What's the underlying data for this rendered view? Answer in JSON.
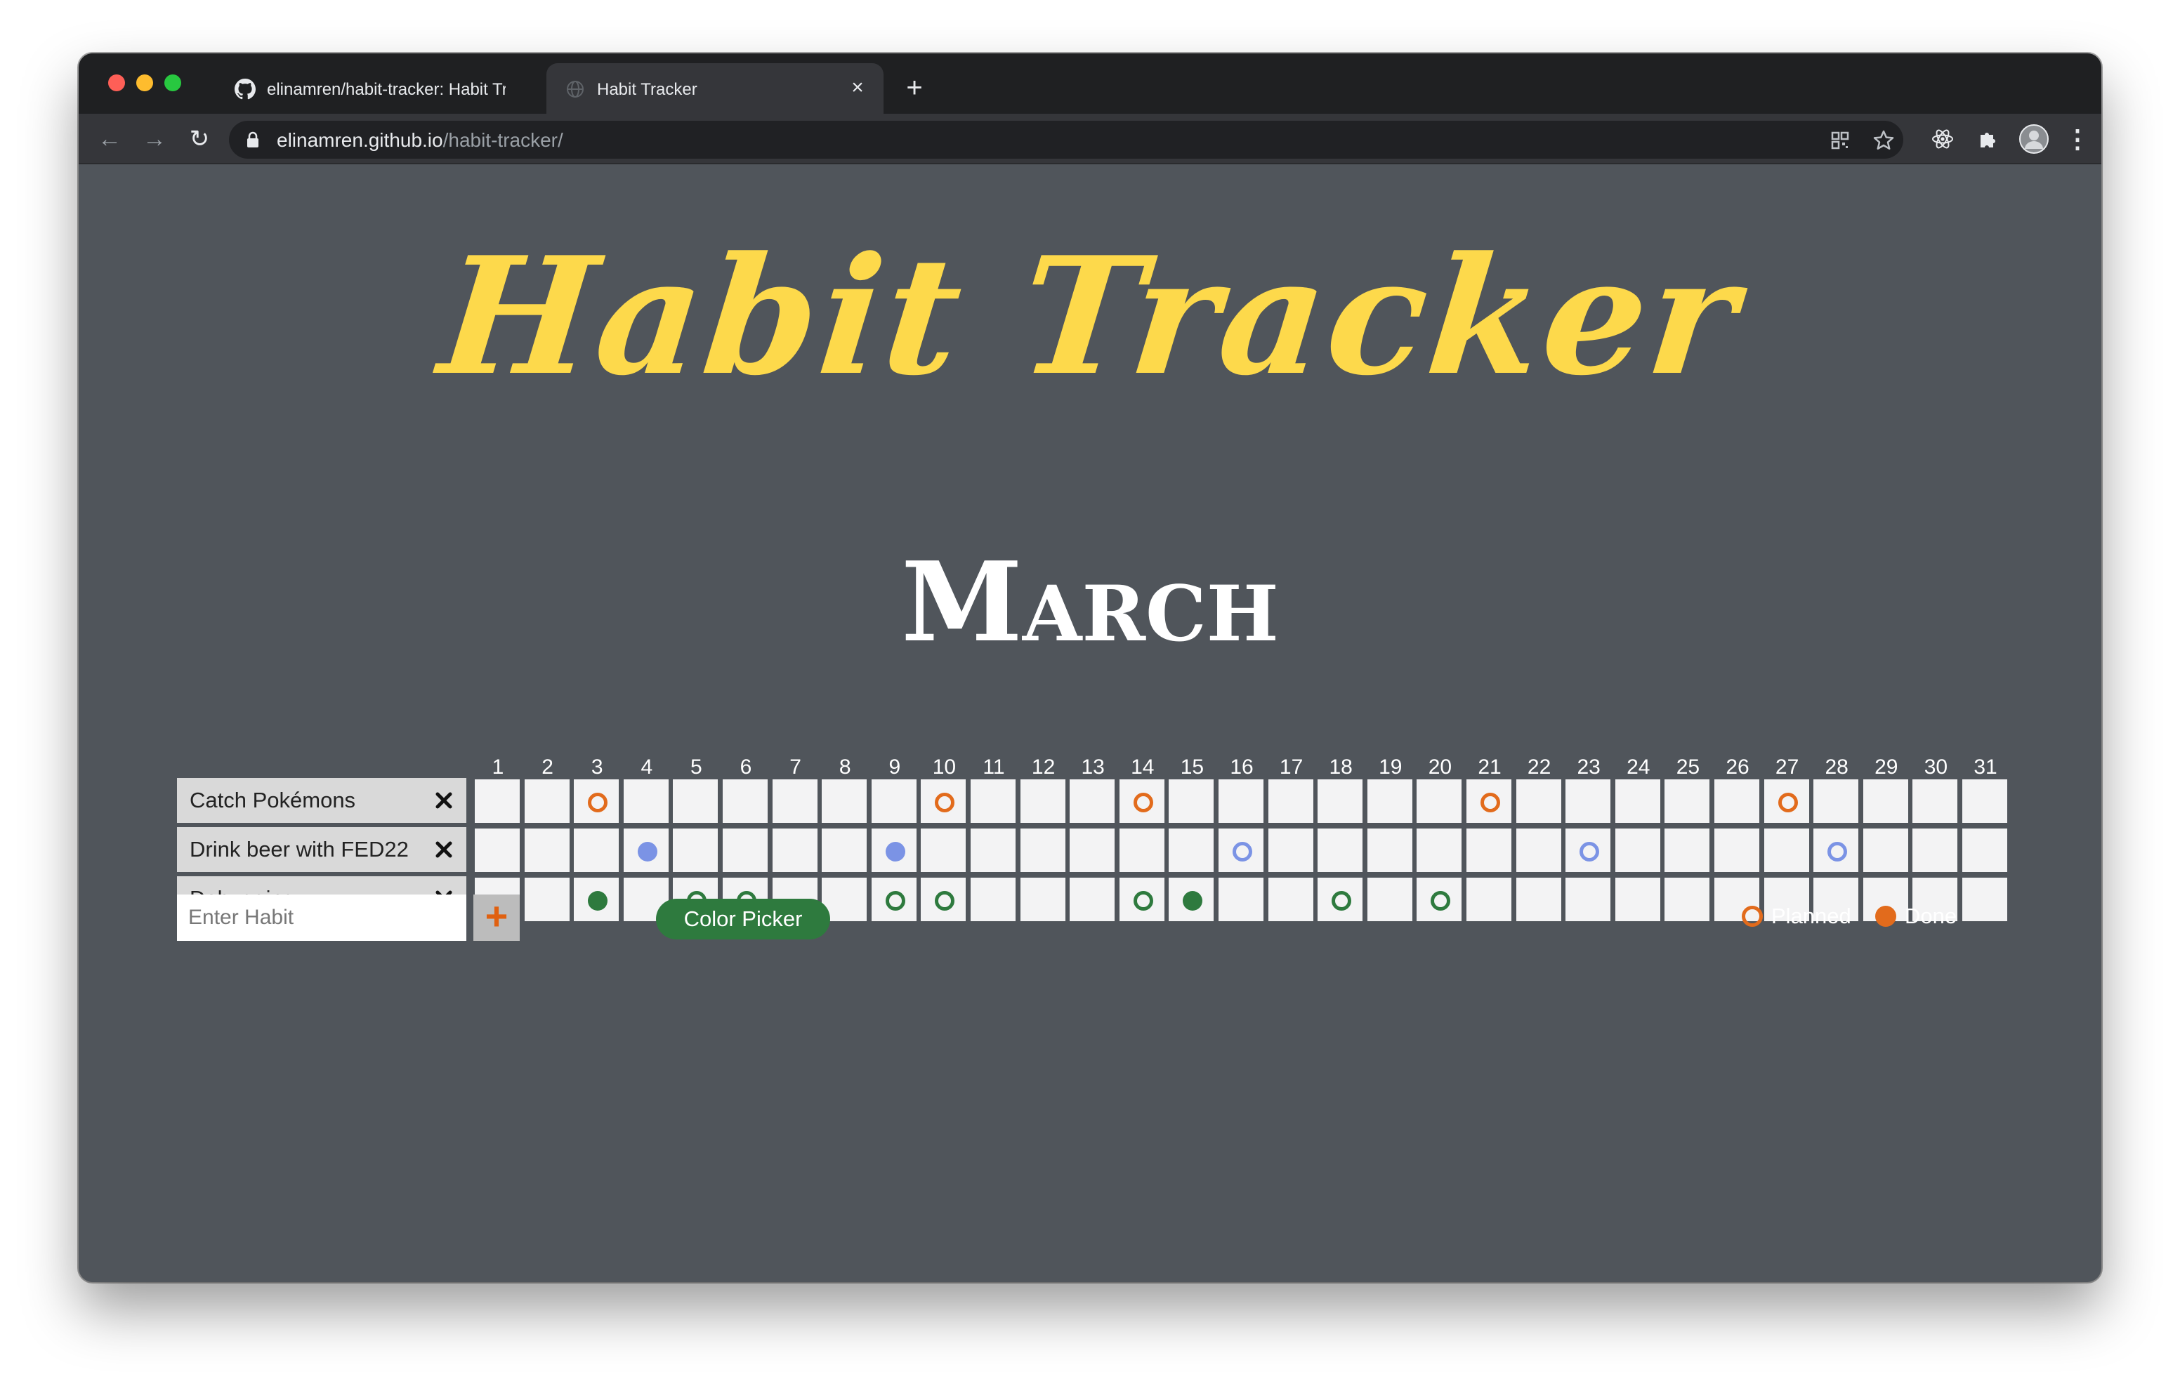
{
  "browser": {
    "tabs": [
      {
        "title": "elinamren/habit-tracker: Habit Tracker",
        "close_label": "×"
      },
      {
        "title": "Habit Tracker",
        "close_label": "×"
      }
    ],
    "new_tab_label": "+",
    "back_label": "←",
    "forward_label": "→",
    "reload_label": "↻",
    "url_host": "elinamren.github.io",
    "url_path": "/habit-tracker/",
    "menu_label": "⋮"
  },
  "app": {
    "title": "Habit Tracker",
    "month": "March",
    "days": [
      "1",
      "2",
      "3",
      "4",
      "5",
      "6",
      "7",
      "8",
      "9",
      "10",
      "11",
      "12",
      "13",
      "14",
      "15",
      "16",
      "17",
      "18",
      "19",
      "20",
      "21",
      "22",
      "23",
      "24",
      "25",
      "26",
      "27",
      "28",
      "29",
      "30",
      "31"
    ],
    "habits": [
      {
        "name": "Catch Pokémons",
        "color": "#e26b1c",
        "marks": {
          "3": "planned",
          "10": "planned",
          "14": "planned",
          "21": "planned",
          "27": "planned"
        }
      },
      {
        "name": "Drink beer with FED22",
        "color": "#7b93e5",
        "marks": {
          "4": "done",
          "9": "done",
          "16": "planned",
          "23": "planned",
          "28": "planned"
        }
      },
      {
        "name": "Debugging",
        "color": "#2e7a3e",
        "marks": {
          "3": "done",
          "5": "planned",
          "6": "planned",
          "9": "planned",
          "10": "planned",
          "14": "planned",
          "15": "done",
          "18": "planned",
          "20": "planned"
        }
      }
    ],
    "input_placeholder": "Enter Habit",
    "add_label": "+",
    "color_picker_label": "Color Picker",
    "legend": {
      "planned_label": "Planned",
      "done_label": "Done",
      "color": "#e26b1c"
    }
  }
}
